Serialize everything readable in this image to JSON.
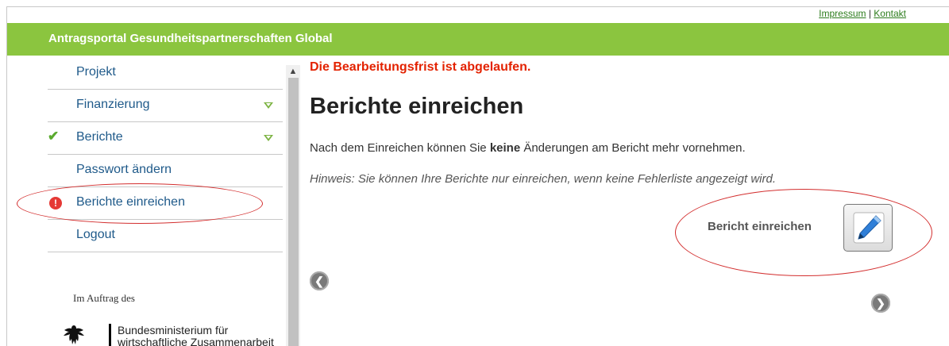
{
  "toplinks": {
    "impressum": "Impressum",
    "separator": "|",
    "kontakt": "Kontakt"
  },
  "header": {
    "title": "Antragsportal Gesundheitspartnerschaften Global"
  },
  "sidebar": {
    "items": [
      {
        "label": "Projekt"
      },
      {
        "label": "Finanzierung"
      },
      {
        "label": "Berichte"
      },
      {
        "label": "Passwort ändern"
      },
      {
        "label": "Berichte einreichen"
      },
      {
        "label": "Logout"
      }
    ],
    "sponsor_text": "Im Auftrag des",
    "ministry_line1": "Bundesministerium für",
    "ministry_line2": "wirtschaftliche Zusammenarbeit"
  },
  "main": {
    "deadline_notice": "Die Bearbeitungsfrist ist abgelaufen.",
    "title": "Berichte einreichen",
    "intro_before": "Nach dem Einreichen können Sie ",
    "intro_bold": "keine",
    "intro_after": " Änderungen am Bericht mehr vornehmen.",
    "hint": "Hinweis: Sie können Ihre Berichte nur einreichen, wenn keine Fehlerliste angezeigt wird.",
    "submit_label": "Bericht einreichen"
  },
  "icons": {
    "check": "check-icon",
    "warning": "warning-icon",
    "pencil": "pencil-icon",
    "prev": "arrow-left-icon",
    "next": "arrow-right-icon"
  },
  "colors": {
    "banner": "#8bc53f",
    "nav_text": "#1f5a8a",
    "deadline": "#e32200",
    "annotation_ring": "#d32f2f"
  }
}
